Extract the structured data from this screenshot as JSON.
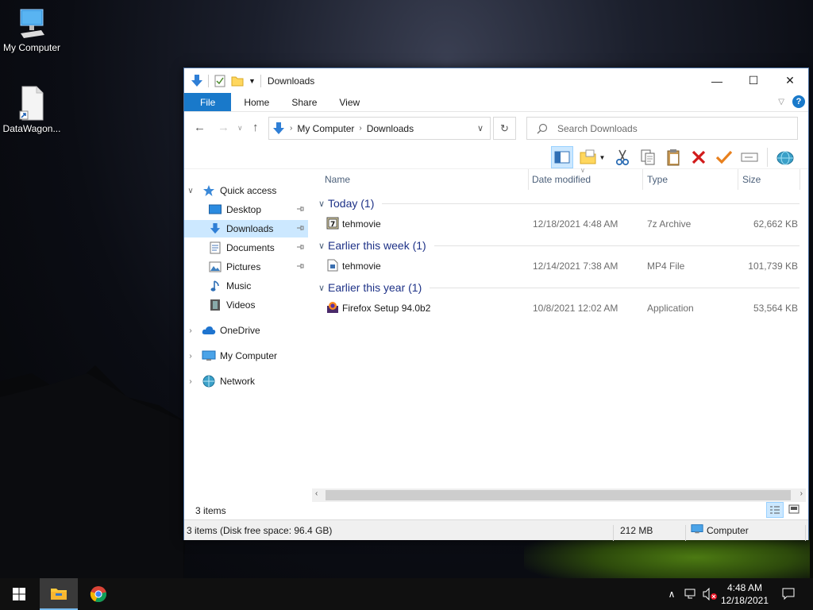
{
  "desktop": {
    "icons": [
      {
        "label": "My Computer",
        "icon": "monitor-icon"
      },
      {
        "label": "DataWagon...",
        "icon": "document-shortcut-icon"
      }
    ]
  },
  "window": {
    "title": "Downloads",
    "controls": {
      "minimize": "—",
      "maximize": "☐",
      "close": "✕"
    },
    "ribbon_tabs": [
      "File",
      "Home",
      "Share",
      "View"
    ],
    "address": {
      "root": "My Computer",
      "current": "Downloads"
    },
    "search_placeholder": "Search Downloads",
    "nav_pane": {
      "quick_access": "Quick access",
      "items": [
        "Desktop",
        "Downloads",
        "Documents",
        "Pictures",
        "Music",
        "Videos"
      ],
      "roots": [
        "OneDrive",
        "My Computer",
        "Network"
      ]
    },
    "columns": [
      "Name",
      "Date modified",
      "Type",
      "Size"
    ],
    "groups": [
      {
        "label": "Today (1)",
        "files": [
          {
            "name": "tehmovie",
            "date": "12/18/2021 4:48 AM",
            "type": "7z Archive",
            "size": "62,662 KB",
            "icon": "archive-icon"
          }
        ]
      },
      {
        "label": "Earlier this week (1)",
        "files": [
          {
            "name": "tehmovie",
            "date": "12/14/2021 7:38 AM",
            "type": "MP4 File",
            "size": "101,739 KB",
            "icon": "video-file-icon"
          }
        ]
      },
      {
        "label": "Earlier this year (1)",
        "files": [
          {
            "name": "Firefox Setup 94.0b2",
            "date": "10/8/2021 12:02 AM",
            "type": "Application",
            "size": "53,564 KB",
            "icon": "firefox-installer-icon"
          }
        ]
      }
    ],
    "item_count": "3 items",
    "status": {
      "left": "3 items (Disk free space: 96.4 GB)",
      "size": "212 MB",
      "location": "Computer"
    }
  },
  "taskbar": {
    "time": "4:48 AM",
    "date": "12/18/2021"
  },
  "colors": {
    "accent": "#1979ca",
    "selection": "#cce8ff",
    "group_text": "#1e3287"
  }
}
